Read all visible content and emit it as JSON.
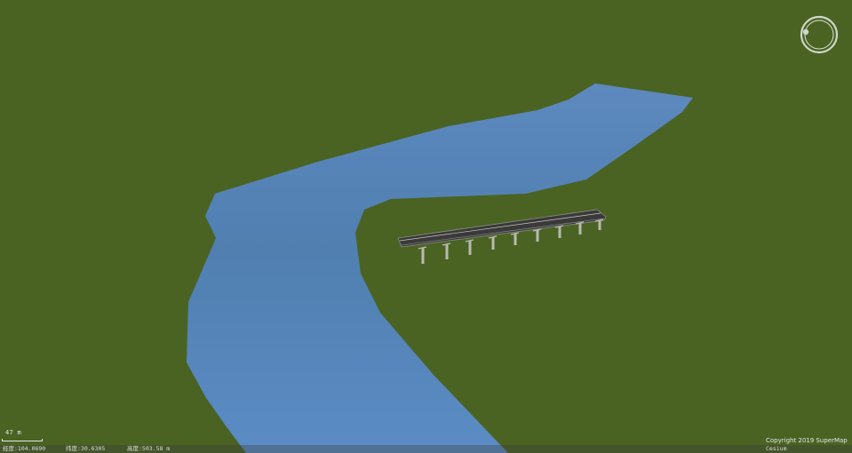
{
  "map": {
    "colors": {
      "terrain": "#4a6323",
      "river": "#5b88bd",
      "bridge_deck": "#3a3a3a",
      "bridge_pier": "#b9b9b0"
    },
    "features": [
      "terrain",
      "river",
      "bridge"
    ],
    "compass": {
      "icon": "compass-icon"
    },
    "scale": {
      "label": "47 m"
    },
    "status": {
      "longitude": "经度:104.0690",
      "latitude": "纬度:30.6305",
      "height": "高度:503.58 m"
    },
    "copyright": "Copyright 2019 SuperMap",
    "copyright_sub": "Cesium"
  }
}
